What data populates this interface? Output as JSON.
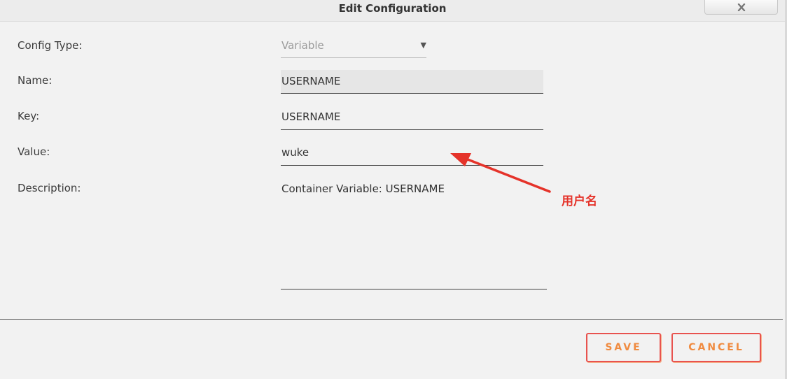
{
  "dialog": {
    "title": "Edit Configuration"
  },
  "form": {
    "config_type": {
      "label": "Config Type:",
      "value": "Variable"
    },
    "name": {
      "label": "Name:",
      "value": "USERNAME"
    },
    "key": {
      "label": "Key:",
      "value": "USERNAME"
    },
    "value": {
      "label": "Value:",
      "value": "wuke"
    },
    "description": {
      "label": "Description:",
      "value": "Container Variable: USERNAME"
    }
  },
  "annotation": {
    "text": "用户名",
    "color": "#e5332a"
  },
  "buttons": {
    "save": "SAVE",
    "cancel": "CANCEL"
  },
  "colors": {
    "button_border": "#e8534f",
    "button_text": "#f08b40",
    "background": "#f2f2f2"
  },
  "icons": {
    "close": "close-icon",
    "dropdown": "chevron-down-icon"
  }
}
